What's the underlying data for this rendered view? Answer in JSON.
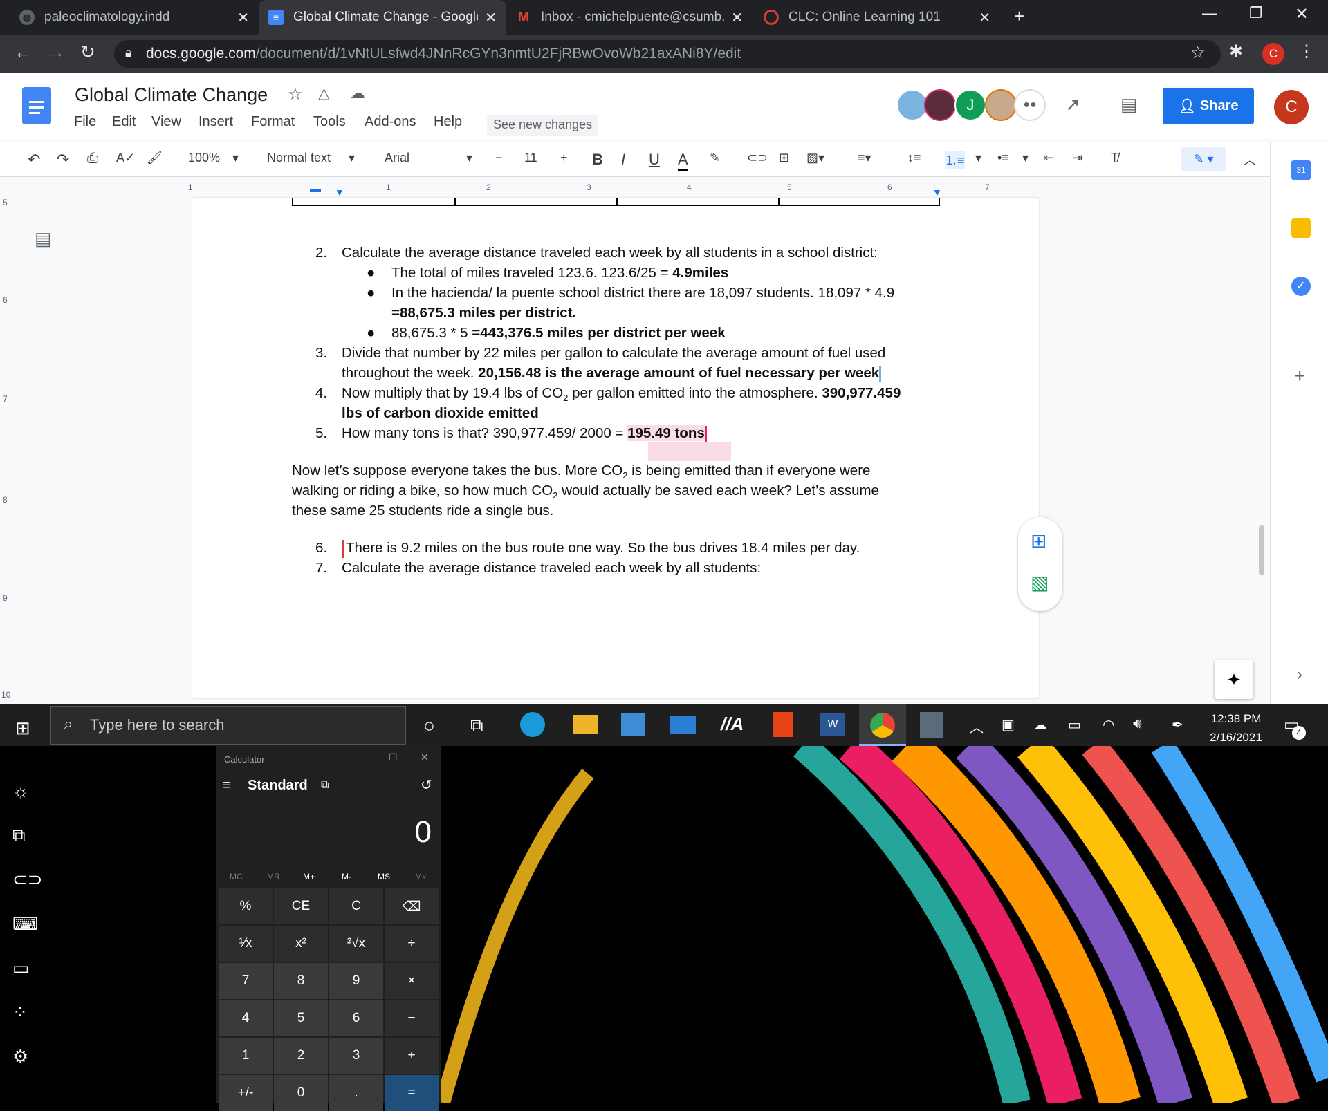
{
  "browser": {
    "tabs": [
      {
        "title": "paleoclimatology.indd",
        "icon": "globe-icon"
      },
      {
        "title": "Global Climate Change - Google",
        "icon": "docs-icon"
      },
      {
        "title": "Inbox - cmichelpuente@csumb.e",
        "icon": "gmail-icon"
      },
      {
        "title": "CLC: Online Learning 101",
        "icon": "canvas-icon"
      }
    ],
    "url_host": "docs.google.com",
    "url_path": "/document/d/1vNtULsfwd4JNnRcGYn3nmtU2FjRBwOvoWb21axANi8Y/edit",
    "profile_letter": "C"
  },
  "docs": {
    "title": "Global Climate Change",
    "menus": [
      "File",
      "Edit",
      "View",
      "Insert",
      "Format",
      "Tools",
      "Add-ons",
      "Help"
    ],
    "see_changes": "See new changes",
    "share": "Share",
    "user_letter": "C",
    "collab_letter": "J",
    "toolbar": {
      "zoom": "100%",
      "style": "Normal text",
      "font": "Arial",
      "size": "11"
    },
    "ruler_marks": [
      "1",
      "1",
      "2",
      "3",
      "4",
      "5",
      "6",
      "7"
    ],
    "vruler_marks": [
      "5",
      "6",
      "7",
      "8",
      "9",
      "10"
    ]
  },
  "document": {
    "items": [
      {
        "num": "2.",
        "text": "Calculate the average distance traveled each week by all students in a school district:"
      },
      {
        "bullet": "The total of miles traveled 123.6. 123.6/25 = ",
        "bold": "4.9miles"
      },
      {
        "bullet": "In the hacienda/ la puente school district there are 18,097 students. 18,097 * 4.9",
        "cont": "=88,675.3 miles per district."
      },
      {
        "bullet": "88,675.3 * 5 ",
        "bold": "=443,376.5 miles per district per week"
      },
      {
        "num": "3.",
        "text": "Divide that number by 22 miles per gallon to calculate the average amount of fuel used",
        "line2": "throughout the week. ",
        "bold": "20,156.48 is the average amount of fuel necessary per week"
      },
      {
        "num": "4.",
        "text": "Now multiply that by 19.4 lbs of CO",
        "sub": "2",
        "text2": " per gallon emitted into the atmosphere. ",
        "bold": "390,977.459",
        "bold2": "lbs of carbon dioxide emitted"
      },
      {
        "num": "5.",
        "text": "How many tons is that? 390,977.459/ 2000 = ",
        "bold": "195.49 tons"
      }
    ],
    "para": {
      "l1a": "Now let’s suppose everyone takes the bus. More CO",
      "l1b": "is being emitted than if everyone were",
      "l2a": "walking or riding a bike, so how much CO",
      "l2b": "would actually be saved each week? Let’s assume",
      "l3": "these same 25 students ride a single bus.",
      "sub": "2"
    },
    "items2": [
      {
        "num": "6.",
        "text": "There is 9.2 miles on the bus route one way. So the bus drives 18.4 miles per day."
      },
      {
        "num": "7.",
        "text": "Calculate the average distance traveled each week by all students:"
      }
    ]
  },
  "taskbar": {
    "search_placeholder": "Type here to search",
    "time": "12:38 PM",
    "date": "2/16/2021",
    "notif_count": "4"
  },
  "calculator": {
    "title": "Calculator",
    "mode": "Standard",
    "display": "0",
    "memory": [
      "MC",
      "MR",
      "M+",
      "M-",
      "MS",
      "M˅"
    ],
    "keys": [
      [
        "%",
        "CE",
        "C",
        "⌫"
      ],
      [
        "¹⁄x",
        "x²",
        "²√x",
        "÷"
      ],
      [
        "7",
        "8",
        "9",
        "×"
      ],
      [
        "4",
        "5",
        "6",
        "−"
      ],
      [
        "1",
        "2",
        "3",
        "+"
      ],
      [
        "+/-",
        "0",
        ".",
        "="
      ]
    ]
  }
}
